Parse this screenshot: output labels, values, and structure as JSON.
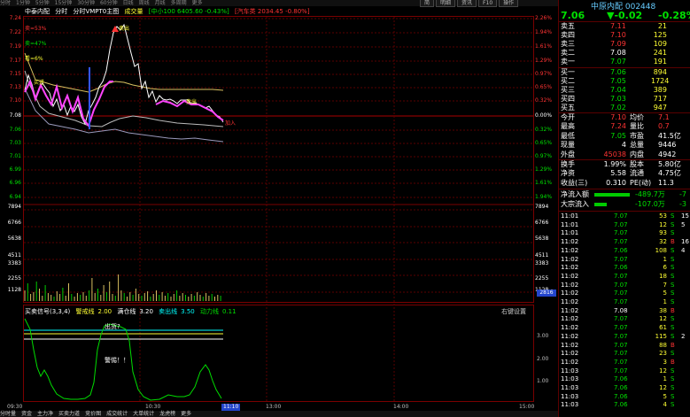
{
  "toolbar": {
    "items": [
      "分时",
      "1分钟",
      "5分钟",
      "15分钟",
      "30分钟",
      "60分钟",
      "日线",
      "周线",
      "月线",
      "多周期",
      "更多"
    ],
    "window_tabs": [
      "简",
      "明细",
      "资讯",
      "F10",
      "操作"
    ]
  },
  "chart_header": {
    "stock": "中泰内配",
    "period": "分时",
    "indicator": "分时VMPT0主图",
    "volume_label": "成交量",
    "index_info": "[中小100 6405.60 -0.43%]",
    "sector_info": "[汽车类 2034.45 -0.80%]"
  },
  "price_axis": {
    "left": [
      "7.24",
      "7.22",
      "7.19",
      "7.17",
      "7.15",
      "7.13",
      "7.10",
      "7.08",
      "7.06",
      "7.03",
      "7.01",
      "6.99",
      "6.96",
      "6.94"
    ],
    "right": [
      "2.26%",
      "1.94%",
      "1.61%",
      "1.29%",
      "0.97%",
      "0.65%",
      "0.32%",
      "0.00%",
      "0.32%",
      "0.65%",
      "0.97%",
      "1.29%",
      "1.61%",
      "1.94%"
    ]
  },
  "volume_axis": {
    "left": [
      "7894",
      "6766",
      "5638",
      "4511",
      "3383",
      "2255",
      "1128"
    ],
    "right": [
      "7894",
      "6766",
      "5638",
      "4511",
      "3383",
      "2255",
      "1128"
    ],
    "current_tag": "2816"
  },
  "annotations": {
    "sell_big": "卖=53%",
    "sell_mid": "卖=47%",
    "buy": "看=6%",
    "buy_in": "买进",
    "peak": "卖出",
    "mid_a": "卖出",
    "mid_b": "加入"
  },
  "indicator": {
    "name": "买卖信号(3,3,4)",
    "fields": [
      {
        "label": "警戒线",
        "value": "2.00"
      },
      {
        "label": "满仓线",
        "value": "3.20"
      },
      {
        "label": "卖出线",
        "value": "3.50"
      },
      {
        "label": "动力线",
        "value": "0.11"
      }
    ],
    "setting": "右键设置",
    "label_top": "出货?",
    "label_mid": "警惕！！",
    "axis": [
      "3.00",
      "2.00",
      "1.00"
    ]
  },
  "time_axis": [
    "09:30",
    "10:30",
    "11:10",
    "13:00",
    "14:00",
    "15:00"
  ],
  "bottom_tabs": [
    "分时量",
    "资金",
    "主力净",
    "买卖力道",
    "竞价图",
    "成交统计",
    "大单统计",
    "龙虎榜",
    "更多"
  ],
  "quote": {
    "code": "中原内配 002448",
    "price": "7.06",
    "change": "▼-0.02",
    "change_pct": "-0.28%",
    "colors": {
      "up": "#ff3333",
      "down": "#00e000",
      "flat": "#ffffff"
    },
    "asks": [
      {
        "label": "卖五",
        "price": "7.11",
        "vol": "21",
        "dir": "up"
      },
      {
        "label": "卖四",
        "price": "7.10",
        "vol": "125",
        "dir": "up"
      },
      {
        "label": "卖三",
        "price": "7.09",
        "vol": "109",
        "dir": "up"
      },
      {
        "label": "卖二",
        "price": "7.08",
        "vol": "241",
        "dir": "flat"
      },
      {
        "label": "卖一",
        "price": "7.07",
        "vol": "191",
        "dir": "down"
      }
    ],
    "bids": [
      {
        "label": "买一",
        "price": "7.06",
        "vol": "894",
        "dir": "down"
      },
      {
        "label": "买二",
        "price": "7.05",
        "vol": "1724",
        "dir": "down"
      },
      {
        "label": "买三",
        "price": "7.04",
        "vol": "389",
        "dir": "down"
      },
      {
        "label": "买四",
        "price": "7.03",
        "vol": "717",
        "dir": "down"
      },
      {
        "label": "买五",
        "price": "7.02",
        "vol": "947",
        "dir": "down"
      }
    ],
    "stats": [
      {
        "l1": "今开",
        "v1": "7.10",
        "c1": "up",
        "l2": "均价",
        "v2": "7.1"
      },
      {
        "l1": "最高",
        "v1": "7.24",
        "c1": "up",
        "l2": "量比",
        "v2": "0.7"
      },
      {
        "l1": "最低",
        "v1": "7.05",
        "c1": "down",
        "l2": "市盈",
        "v2": "41.5亿"
      },
      {
        "l1": "现量",
        "v1": "4",
        "c1": "flat",
        "l2": "总量",
        "v2": "9446"
      },
      {
        "l1": "外盘",
        "v1": "45038",
        "c1": "up",
        "l2": "内盘",
        "v2": "4942"
      }
    ],
    "stats2": [
      {
        "l1": "换手",
        "v1": "1.99%",
        "l2": "股本",
        "v2": "5.80亿"
      },
      {
        "l1": "净资",
        "v1": "5.58",
        "l2": "流通",
        "v2": "4.75亿"
      },
      {
        "l1": "收益(三)",
        "v1": "0.310",
        "l2": "PE(动)",
        "v2": "11.3"
      }
    ],
    "flows": [
      {
        "label": "净流入额",
        "value": "-489.7万",
        "extra": "-7"
      },
      {
        "label": "大宗流入",
        "value": "-107.0万",
        "extra": "-3"
      }
    ]
  },
  "ticks": [
    {
      "t": "11:01",
      "p": "7.07",
      "v": "53",
      "bs": "S",
      "x": "15"
    },
    {
      "t": "11:01",
      "p": "7.07",
      "v": "12",
      "bs": "S",
      "x": "5"
    },
    {
      "t": "11:01",
      "p": "7.07",
      "v": "93",
      "bs": "S",
      "x": ""
    },
    {
      "t": "11:02",
      "p": "7.07",
      "v": "32",
      "bs": "B",
      "x": "16"
    },
    {
      "t": "11:02",
      "p": "7.06",
      "v": "108",
      "bs": "S",
      "x": "4"
    },
    {
      "t": "11:02",
      "p": "7.07",
      "v": "1",
      "bs": "S",
      "x": ""
    },
    {
      "t": "11:02",
      "p": "7.06",
      "v": "6",
      "bs": "S",
      "x": ""
    },
    {
      "t": "11:02",
      "p": "7.07",
      "v": "18",
      "bs": "S",
      "x": ""
    },
    {
      "t": "11:02",
      "p": "7.07",
      "v": "7",
      "bs": "S",
      "x": ""
    },
    {
      "t": "11:02",
      "p": "7.07",
      "v": "5",
      "bs": "S",
      "x": ""
    },
    {
      "t": "11:02",
      "p": "7.07",
      "v": "1",
      "bs": "S",
      "x": ""
    },
    {
      "t": "11:02",
      "p": "7.08",
      "v": "38",
      "bs": "B",
      "x": ""
    },
    {
      "t": "11:02",
      "p": "7.07",
      "v": "12",
      "bs": "S",
      "x": ""
    },
    {
      "t": "11:02",
      "p": "7.07",
      "v": "61",
      "bs": "S",
      "x": ""
    },
    {
      "t": "11:02",
      "p": "7.07",
      "v": "115",
      "bs": "S",
      "x": "2"
    },
    {
      "t": "11:02",
      "p": "7.07",
      "v": "88",
      "bs": "B",
      "x": ""
    },
    {
      "t": "11:02",
      "p": "7.07",
      "v": "23",
      "bs": "S",
      "x": ""
    },
    {
      "t": "11:02",
      "p": "7.07",
      "v": "3",
      "bs": "B",
      "x": ""
    },
    {
      "t": "11:03",
      "p": "7.07",
      "v": "12",
      "bs": "S",
      "x": ""
    },
    {
      "t": "11:03",
      "p": "7.06",
      "v": "1",
      "bs": "S",
      "x": ""
    },
    {
      "t": "11:03",
      "p": "7.06",
      "v": "12",
      "bs": "S",
      "x": ""
    },
    {
      "t": "11:03",
      "p": "7.06",
      "v": "5",
      "bs": "S",
      "x": ""
    },
    {
      "t": "11:03",
      "p": "7.06",
      "v": "4",
      "bs": "S",
      "x": ""
    }
  ]
}
